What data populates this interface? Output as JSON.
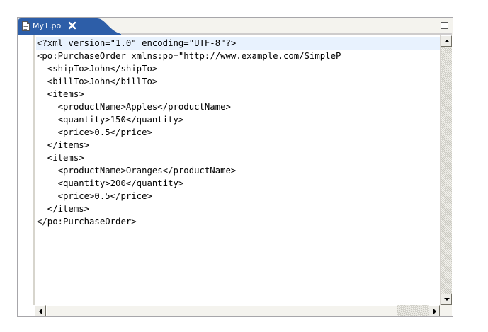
{
  "editor": {
    "tab": {
      "label": "My1.po",
      "icon": "document-icon",
      "close_icon": "close-icon"
    },
    "maximize_icon": "maximize-icon",
    "colors": {
      "tab_active": "#2d5ea8",
      "current_line": "#e8f2fe",
      "frame": "#f4f3ee"
    },
    "lines": [
      "<?xml version=\"1.0\" encoding=\"UTF-8\"?>",
      "<po:PurchaseOrder xmlns:po=\"http://www.example.com/SimpleP",
      "  <shipTo>John</shipTo>",
      "  <billTo>John</billTo>",
      "  <items>",
      "    <productName>Apples</productName>",
      "    <quantity>150</quantity>",
      "    <price>0.5</price>",
      "  </items>",
      "  <items>",
      "    <productName>Oranges</productName>",
      "    <quantity>200</quantity>",
      "    <price>0.5</price>",
      "  </items>",
      "</po:PurchaseOrder>"
    ]
  }
}
